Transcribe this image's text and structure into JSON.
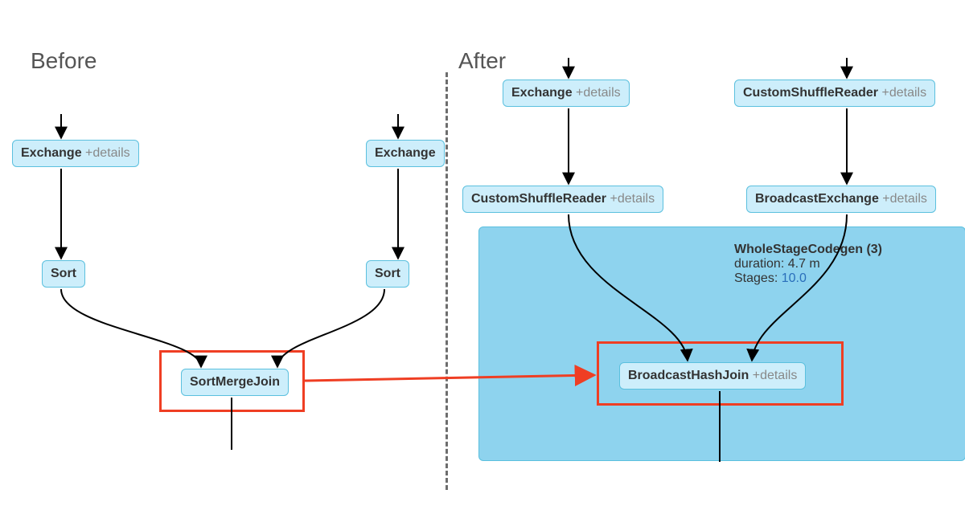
{
  "titles": {
    "before": "Before",
    "after": "After"
  },
  "details_label": "+details",
  "before": {
    "exchange_left": "Exchange",
    "exchange_right": "Exchange",
    "sort_left": "Sort",
    "sort_right": "Sort",
    "join": "SortMergeJoin"
  },
  "after": {
    "exchange": "Exchange",
    "custom_shuffle_top": "CustomShuffleReader",
    "custom_shuffle_left": "CustomShuffleReader",
    "broadcast_exchange": "BroadcastExchange",
    "join": "BroadcastHashJoin",
    "codegen": {
      "heading": "WholeStageCodegen (3)",
      "duration_label": "duration:",
      "duration_value": "4.7 m",
      "stages_label": "Stages:",
      "stages_value": "10.0"
    }
  },
  "colors": {
    "node_fill": "#cdeefb",
    "node_border": "#5bc0de",
    "codegen_fill": "#8ed3ee",
    "highlight": "#ef3e23",
    "link": "#2a6fbb"
  },
  "chart_data": {
    "type": "flow-diagram",
    "before": {
      "nodes": [
        {
          "id": "b_ex_l",
          "label": "Exchange"
        },
        {
          "id": "b_ex_r",
          "label": "Exchange"
        },
        {
          "id": "b_sort_l",
          "label": "Sort"
        },
        {
          "id": "b_sort_r",
          "label": "Sort"
        },
        {
          "id": "b_join",
          "label": "SortMergeJoin",
          "highlighted": true
        }
      ],
      "edges": [
        [
          "b_ex_l",
          "b_sort_l"
        ],
        [
          "b_ex_r",
          "b_sort_r"
        ],
        [
          "b_sort_l",
          "b_join"
        ],
        [
          "b_sort_r",
          "b_join"
        ]
      ]
    },
    "after": {
      "nodes": [
        {
          "id": "a_ex",
          "label": "Exchange"
        },
        {
          "id": "a_csr_top",
          "label": "CustomShuffleReader"
        },
        {
          "id": "a_csr_left",
          "label": "CustomShuffleReader"
        },
        {
          "id": "a_bex",
          "label": "BroadcastExchange"
        },
        {
          "id": "a_join",
          "label": "BroadcastHashJoin",
          "highlighted": true
        }
      ],
      "edges": [
        [
          "a_ex",
          "a_csr_left"
        ],
        [
          "a_csr_top",
          "a_bex"
        ],
        [
          "a_csr_left",
          "a_join"
        ],
        [
          "a_bex",
          "a_join"
        ]
      ],
      "codegen_block": {
        "heading": "WholeStageCodegen (3)",
        "duration": "4.7 m",
        "stages": "10.0",
        "contains": [
          "a_join"
        ]
      }
    },
    "transition_arrow": {
      "from": "b_join",
      "to": "a_join"
    }
  }
}
